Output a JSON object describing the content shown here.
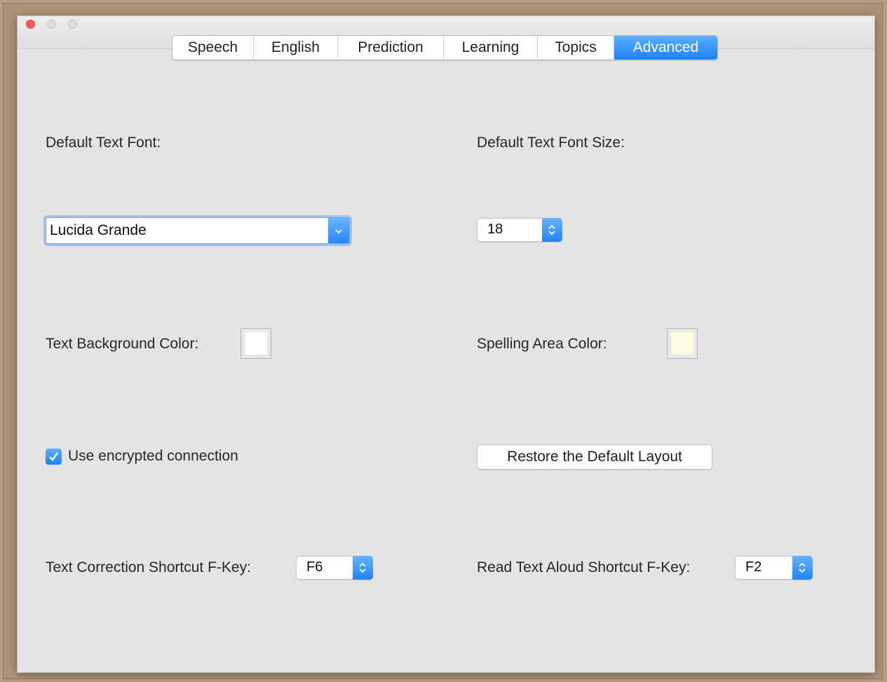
{
  "tabs": [
    "Speech",
    "English",
    "Prediction",
    "Learning",
    "Topics",
    "Advanced"
  ],
  "active_tab": "Advanced",
  "font": {
    "label": "Default Text Font:",
    "value": "Lucida Grande"
  },
  "font_size": {
    "label": "Default Text Font Size:",
    "value": "18"
  },
  "text_background": {
    "label": "Text Background Color:",
    "color": "#ffffff"
  },
  "spelling_area": {
    "label": "Spelling Area Color:",
    "color": "#fffbe0"
  },
  "encrypted": {
    "label": "Use encrypted connection",
    "checked": true
  },
  "restore_button": "Restore the Default Layout",
  "correction_shortcut": {
    "label": "Text Correction Shortcut F-Key:",
    "value": "F6"
  },
  "read_aloud_shortcut": {
    "label": "Read Text Aloud Shortcut F-Key:",
    "value": "F2"
  },
  "colors": {
    "accent": "#1e82f6",
    "close": "#fc5b57"
  }
}
